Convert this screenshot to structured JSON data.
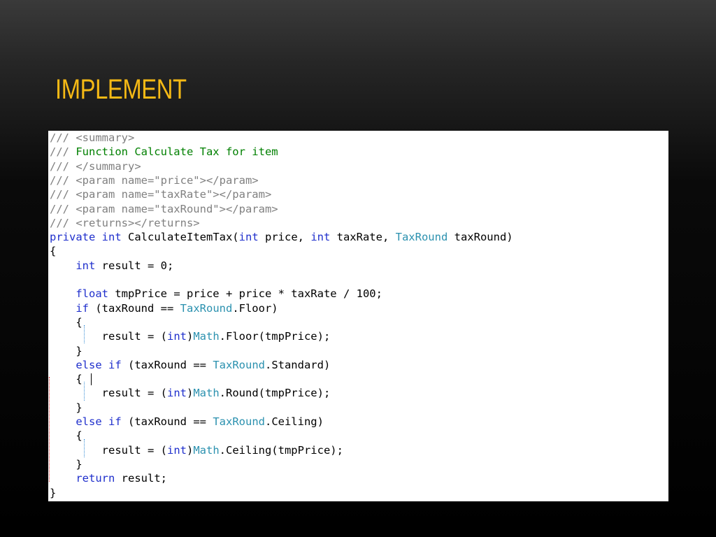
{
  "slide": {
    "title": "IMPLEMENT"
  },
  "colors": {
    "title": "#f5b915",
    "keyword": "#1f2fcc",
    "type_name": "#2b91af",
    "comment_gray": "#808080",
    "comment_green": "#008000",
    "text": "#000000"
  },
  "code_lines": [
    [
      {
        "t": "/// <summary>",
        "c": "g"
      }
    ],
    [
      {
        "t": "/// ",
        "c": "g"
      },
      {
        "t": "Function Calculate Tax for item",
        "c": "c"
      }
    ],
    [
      {
        "t": "/// </summary>",
        "c": "g"
      }
    ],
    [
      {
        "t": "/// <param name=\"price\"></param>",
        "c": "g"
      }
    ],
    [
      {
        "t": "/// <param name=\"taxRate\"></param>",
        "c": "g"
      }
    ],
    [
      {
        "t": "/// <param name=\"taxRound\"></param>",
        "c": "g"
      }
    ],
    [
      {
        "t": "/// <returns></returns>",
        "c": "g"
      }
    ],
    [
      {
        "t": "private",
        "c": "k"
      },
      {
        "t": " ",
        "c": "n"
      },
      {
        "t": "int",
        "c": "k"
      },
      {
        "t": " CalculateItemTax(",
        "c": "n"
      },
      {
        "t": "int",
        "c": "k"
      },
      {
        "t": " price, ",
        "c": "n"
      },
      {
        "t": "int",
        "c": "k"
      },
      {
        "t": " taxRate, ",
        "c": "n"
      },
      {
        "t": "TaxRound",
        "c": "t"
      },
      {
        "t": " taxRound)",
        "c": "n"
      }
    ],
    [
      {
        "t": "{",
        "c": "n"
      }
    ],
    [
      {
        "t": "    ",
        "c": "n"
      },
      {
        "t": "int",
        "c": "k"
      },
      {
        "t": " result = 0;",
        "c": "n"
      }
    ],
    [],
    [
      {
        "t": "    ",
        "c": "n"
      },
      {
        "t": "float",
        "c": "k"
      },
      {
        "t": " tmpPrice = price + price * taxRate / 100;",
        "c": "n"
      }
    ],
    [
      {
        "t": "    ",
        "c": "n"
      },
      {
        "t": "if",
        "c": "k"
      },
      {
        "t": " (taxRound == ",
        "c": "n"
      },
      {
        "t": "TaxRound",
        "c": "t"
      },
      {
        "t": ".Floor)",
        "c": "n"
      }
    ],
    [
      {
        "t": "    {",
        "c": "n"
      }
    ],
    [
      {
        "t": "        result = (",
        "c": "n"
      },
      {
        "t": "int",
        "c": "k"
      },
      {
        "t": ")",
        "c": "n"
      },
      {
        "t": "Math",
        "c": "t"
      },
      {
        "t": ".Floor(tmpPrice);",
        "c": "n"
      }
    ],
    [
      {
        "t": "    }",
        "c": "n"
      }
    ],
    [
      {
        "t": "    ",
        "c": "n"
      },
      {
        "t": "else",
        "c": "k"
      },
      {
        "t": " ",
        "c": "n"
      },
      {
        "t": "if",
        "c": "k"
      },
      {
        "t": " (taxRound == ",
        "c": "n"
      },
      {
        "t": "TaxRound",
        "c": "t"
      },
      {
        "t": ".Standard)",
        "c": "n"
      }
    ],
    [
      {
        "t": "    {",
        "c": "n"
      }
    ],
    [
      {
        "t": "        result = (",
        "c": "n"
      },
      {
        "t": "int",
        "c": "k"
      },
      {
        "t": ")",
        "c": "n"
      },
      {
        "t": "Math",
        "c": "t"
      },
      {
        "t": ".Round(tmpPrice);",
        "c": "n"
      }
    ],
    [
      {
        "t": "    }",
        "c": "n"
      }
    ],
    [
      {
        "t": "    ",
        "c": "n"
      },
      {
        "t": "else",
        "c": "k"
      },
      {
        "t": " ",
        "c": "n"
      },
      {
        "t": "if",
        "c": "k"
      },
      {
        "t": " (taxRound == ",
        "c": "n"
      },
      {
        "t": "TaxRound",
        "c": "t"
      },
      {
        "t": ".Ceiling)",
        "c": "n"
      }
    ],
    [
      {
        "t": "    {",
        "c": "n"
      }
    ],
    [
      {
        "t": "        result = (",
        "c": "n"
      },
      {
        "t": "int",
        "c": "k"
      },
      {
        "t": ")",
        "c": "n"
      },
      {
        "t": "Math",
        "c": "t"
      },
      {
        "t": ".Ceiling(tmpPrice);",
        "c": "n"
      }
    ],
    [
      {
        "t": "    }",
        "c": "n"
      }
    ],
    [
      {
        "t": "    ",
        "c": "n"
      },
      {
        "t": "return",
        "c": "k"
      },
      {
        "t": " result;",
        "c": "n"
      }
    ],
    [
      {
        "t": "}",
        "c": "n"
      }
    ]
  ]
}
